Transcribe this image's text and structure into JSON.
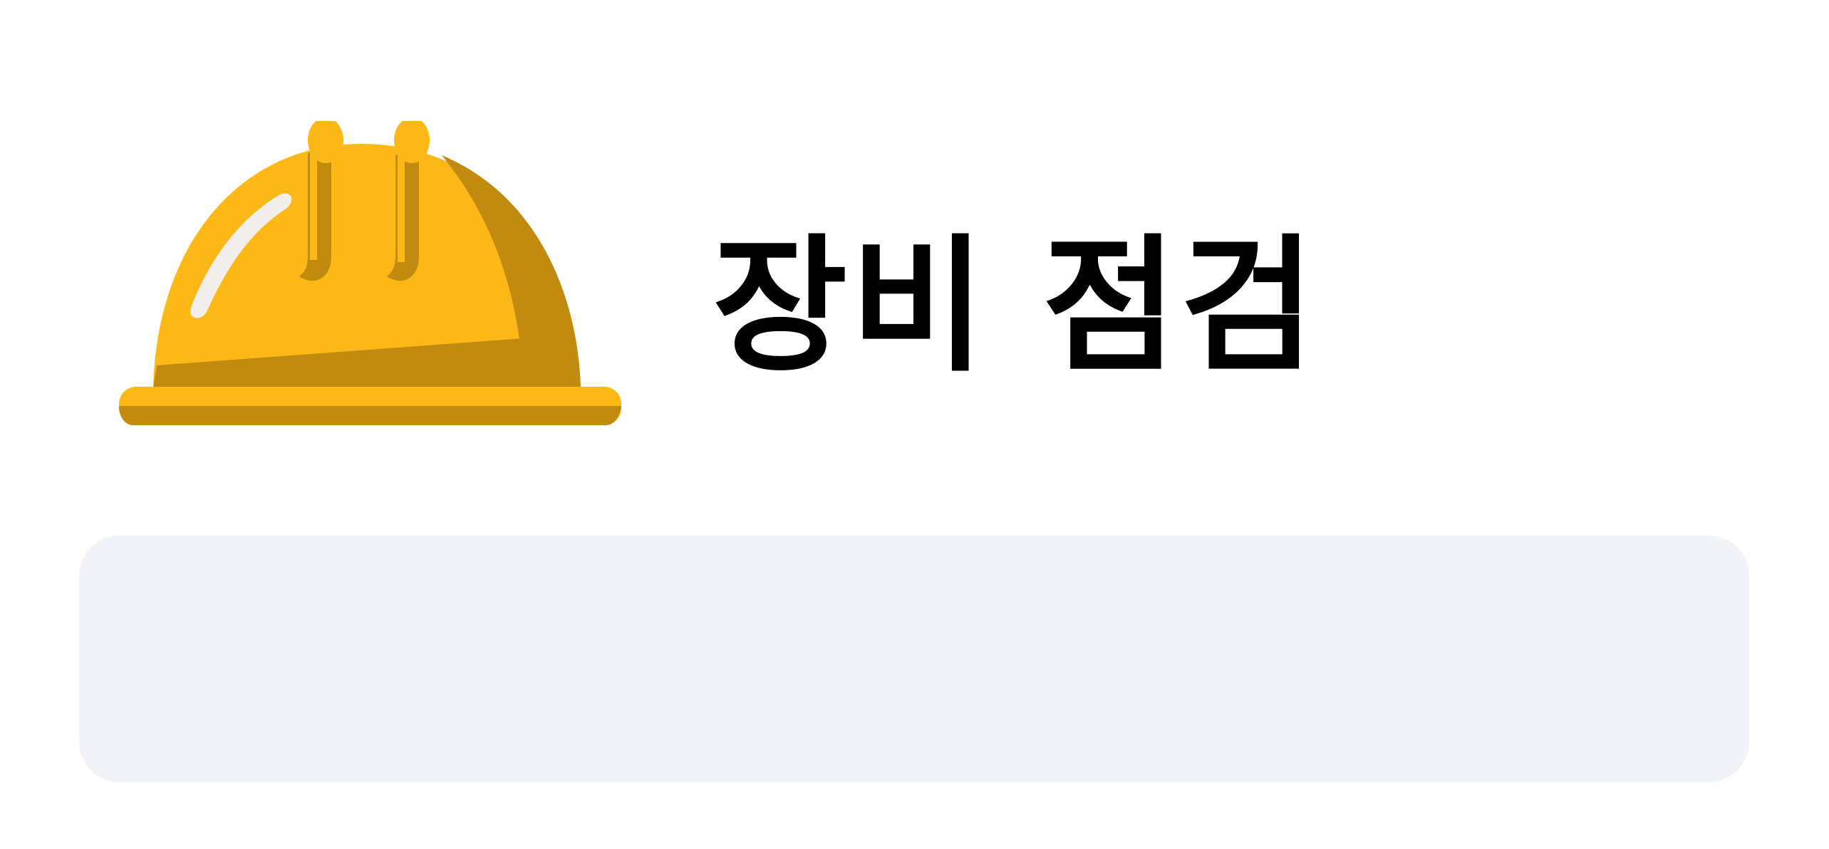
{
  "header": {
    "title": "장비 점검",
    "icon": "hard-hat-icon"
  },
  "colors": {
    "helmet_yellow": "#fbb817",
    "helmet_shadow": "#c08b0f",
    "helmet_highlight": "#f1eeeb",
    "panel_background": "#f2f3f8",
    "page_background": "#ffffff",
    "title_text": "#000000"
  }
}
